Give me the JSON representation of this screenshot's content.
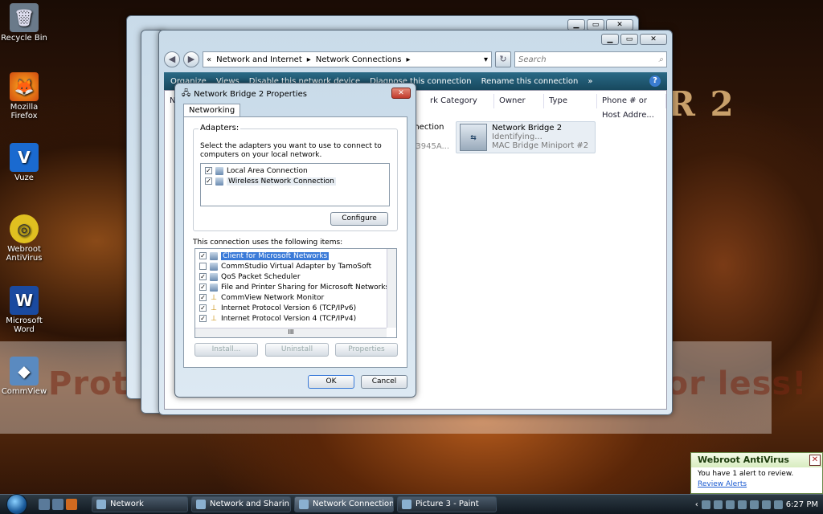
{
  "desktop": {
    "icons": [
      {
        "label": "Recycle Bin",
        "glyph": "🗑"
      },
      {
        "label": "Mozilla Firefox",
        "glyph": "🦊"
      },
      {
        "label": "Vuze",
        "glyph": "V"
      },
      {
        "label": "Webroot AntiVirus",
        "glyph": "◎"
      },
      {
        "label": "Microsoft Word",
        "glyph": "W"
      },
      {
        "label": "CommView",
        "glyph": "◆"
      }
    ],
    "watermark": "Protect more of your memories for less!",
    "wallpaper_logo": "R 2"
  },
  "explorer": {
    "breadcrumb": [
      "Network and Internet",
      "Network Connections"
    ],
    "search_placeholder": "Search",
    "toolbar": [
      "Organize",
      "Views",
      "Disable this network device",
      "Diagnose this connection",
      "Rename this connection"
    ],
    "columns": [
      "N",
      "rk Category",
      "Owner",
      "Type",
      "Phone # or Host Addre..."
    ],
    "partial_text": [
      "nnection",
      "s 3945A..."
    ],
    "item": {
      "name": "Network Bridge 2",
      "status": "Identifying...",
      "device": "MAC Bridge Miniport #2",
      "icon": "bridge-icon"
    }
  },
  "dialog": {
    "title": "Network Bridge 2 Properties",
    "tab": "Networking",
    "adapters_label": "Adapters:",
    "adapters_instruction": "Select the adapters you want to use to connect to computers on your local network.",
    "adapters": [
      {
        "label": "Local Area Connection",
        "checked": true
      },
      {
        "label": "Wireless Network Connection",
        "checked": true
      }
    ],
    "configure_label": "Configure",
    "items_label": "This connection uses the following items:",
    "items": [
      {
        "label": "Client for Microsoft Networks",
        "checked": true,
        "selected": true
      },
      {
        "label": "CommStudio Virtual Adapter by TamoSoft",
        "checked": false,
        "selected": false
      },
      {
        "label": "QoS Packet Scheduler",
        "checked": true,
        "selected": false
      },
      {
        "label": "File and Printer Sharing for Microsoft Networks",
        "checked": true,
        "selected": false
      },
      {
        "label": "CommView Network Monitor",
        "checked": true,
        "selected": false
      },
      {
        "label": "Internet Protocol Version 6 (TCP/IPv6)",
        "checked": true,
        "selected": false
      },
      {
        "label": "Internet Protocol Version 4 (TCP/IPv4)",
        "checked": true,
        "selected": false
      }
    ],
    "install_label": "Install...",
    "uninstall_label": "Uninstall",
    "properties_label": "Properties",
    "ok_label": "OK",
    "cancel_label": "Cancel",
    "hscroll_thumb": "III"
  },
  "notification": {
    "title": "Webroot AntiVirus",
    "message": "You have 1 alert to review.",
    "link": "Review Alerts"
  },
  "taskbar": {
    "tasks": [
      {
        "label": "Network",
        "active": false
      },
      {
        "label": "Network and Sharin...",
        "active": false
      },
      {
        "label": "Network Connections",
        "active": true
      },
      {
        "label": "Picture 3 - Paint",
        "active": false
      }
    ],
    "clock": "6:27 PM"
  },
  "colors": {
    "accent": "#3a7ad8",
    "toolbar": "#17485e"
  }
}
